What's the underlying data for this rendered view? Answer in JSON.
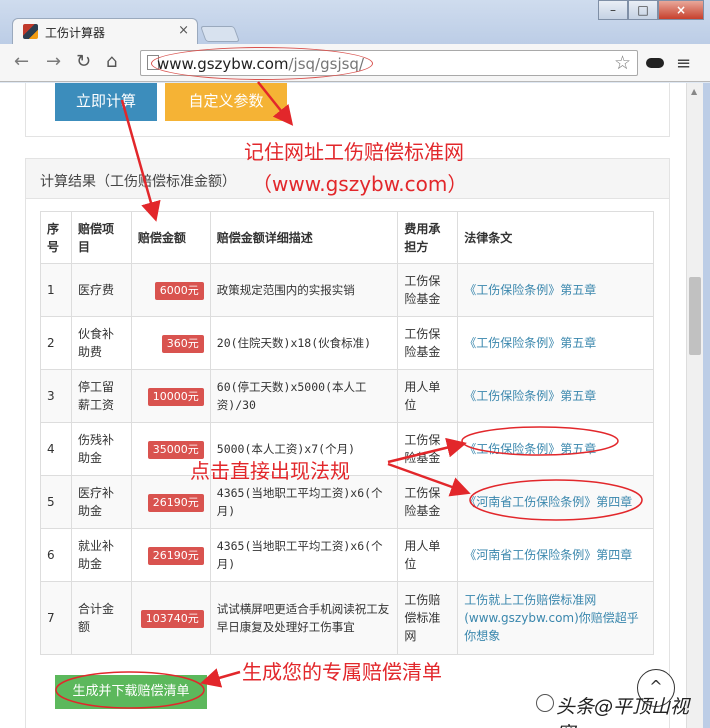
{
  "browser": {
    "tab_title": "工伤计算器",
    "tab_close": "×",
    "url_host": "www.gszybw.com",
    "url_path": "/jsq/gsjsq/",
    "back": "←",
    "forward": "→",
    "reload": "↻",
    "home": "⌂",
    "star": "☆",
    "menu": "≡",
    "window_buttons": [
      "–",
      "□",
      "×"
    ]
  },
  "actions": {
    "calculate_label": "立即计算",
    "custom_params_label": "自定义参数",
    "download_label": "生成并下载赔偿清单",
    "back_to_top": "^"
  },
  "results": {
    "title": "计算结果（工伤赔偿标准金额）",
    "columns": [
      "序号",
      "赔偿项目",
      "赔偿金额",
      "赔偿金额详细描述",
      "费用承担方",
      "法律条文"
    ],
    "rows": [
      {
        "no": "1",
        "item": "医疗费",
        "amount": "6000元",
        "desc": "政策规定范围内的实报实销",
        "payer": "工伤保险基金",
        "law": "《工伤保险条例》第五章"
      },
      {
        "no": "2",
        "item": "伙食补助费",
        "amount": "360元",
        "desc": "20(住院天数)x18(伙食标准)",
        "payer": "工伤保险基金",
        "law": "《工伤保险条例》第五章"
      },
      {
        "no": "3",
        "item": "停工留薪工资",
        "amount": "10000元",
        "desc": "60(停工天数)x5000(本人工资)/30",
        "payer": "用人单位",
        "law": "《工伤保险条例》第五章"
      },
      {
        "no": "4",
        "item": "伤残补助金",
        "amount": "35000元",
        "desc": "5000(本人工资)x7(个月)",
        "payer": "工伤保险基金",
        "law": "《工伤保险条例》第五章"
      },
      {
        "no": "5",
        "item": "医疗补助金",
        "amount": "26190元",
        "desc": "4365(当地职工平均工资)x6(个月)",
        "payer": "工伤保险基金",
        "law": "《河南省工伤保险条例》第四章"
      },
      {
        "no": "6",
        "item": "就业补助金",
        "amount": "26190元",
        "desc": "4365(当地职工平均工资)x6(个月)",
        "payer": "用人单位",
        "law": "《河南省工伤保险条例》第四章"
      },
      {
        "no": "7",
        "item": "合计金额",
        "amount": "103740元",
        "desc": "试试横屏吧更适合手机阅读祝工友早日康复及处理好工伤事宜",
        "payer": "工伤赔偿标准网",
        "law": "工伤就上工伤赔偿标准网(www.gszybw.com)你赔偿超乎你想象"
      }
    ]
  },
  "annotations": {
    "remember_url": "记住网址工伤赔偿标准网",
    "site_url": "（www.gszybw.com）",
    "click_law": "点击直接出现法规",
    "generate_list": "生成您的专属赔偿清单"
  },
  "watermark": {
    "text": "头条@平顶山视窗"
  },
  "colors": {
    "annotation": "#e2272b",
    "calc_button": "#3c8dbc",
    "custom_button": "#f5b335",
    "download_button": "#5cb85c",
    "amount_badge": "#d9534f",
    "law_link": "#3a87ad"
  }
}
